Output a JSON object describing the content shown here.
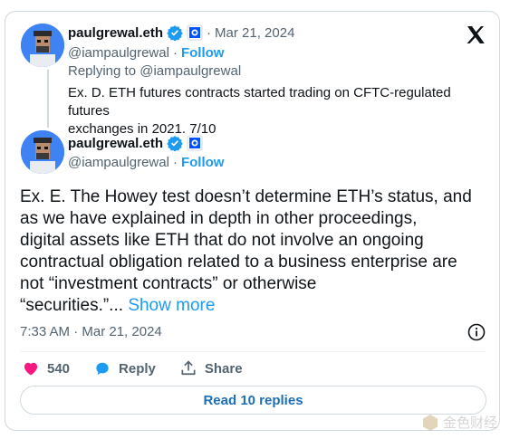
{
  "quoted": {
    "name": "paulgrewal.eth",
    "dot": "·",
    "date": "Mar 21, 2024",
    "handle": "@iampaulgrewal",
    "follow": "Follow",
    "replying_to": "Replying to @iampaulgrewal",
    "text_line1": "Ex. D. ETH futures contracts started trading on CFTC-regulated futures",
    "text_line2": "exchanges in 2021. 7/10"
  },
  "main": {
    "name": "paulgrewal.eth",
    "handle": "@iampaulgrewal",
    "dot": "·",
    "follow": "Follow",
    "text_lines": [
      "Ex. E. The Howey test doesn’t determine ETH’s status, and",
      "as we have explained in depth in other proceedings,",
      "digital assets like ETH that do not involve an ongoing",
      "contractual obligation related to a business enterprise are",
      "not “investment contracts” or otherwise"
    ],
    "text_last": "“securities.”...",
    "show_more": "Show more",
    "timestamp": "7:33 AM · Mar 21, 2024"
  },
  "actions": {
    "like_count": "540",
    "reply_label": "Reply",
    "share_label": "Share"
  },
  "read_replies": "Read 10 replies",
  "watermark": "金色财经",
  "colors": {
    "accent": "#1d9bf0",
    "like": "#f91880",
    "border": "#cfd9de"
  }
}
